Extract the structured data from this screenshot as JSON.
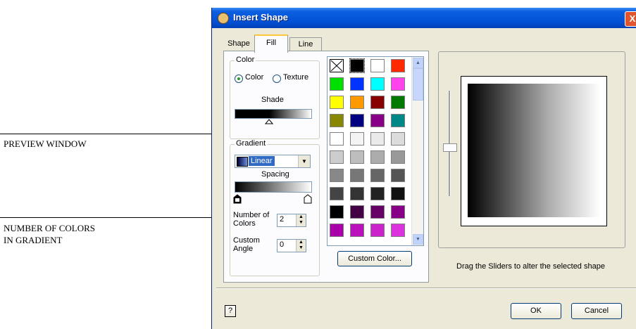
{
  "annotations": {
    "preview_window": "PREVIEW WINDOW",
    "num_colors_line1": "NUMBER OF COLORS",
    "num_colors_line2": "IN GRADIENT"
  },
  "dialog": {
    "title": "Insert Shape",
    "close_glyph": "X",
    "tabs": [
      "Shape",
      "Fill",
      "Line"
    ],
    "active_tab": "Fill"
  },
  "color_group": {
    "label": "Color",
    "radio_color": "Color",
    "radio_texture": "Texture",
    "selected": "Color",
    "shade_label": "Shade"
  },
  "gradient_group": {
    "label": "Gradient",
    "type_value": "Linear",
    "spacing_label": "Spacing",
    "num_colors_label_1": "Number of",
    "num_colors_label_2": "Colors",
    "num_colors_value": "2",
    "custom_angle_label_1": "Custom",
    "custom_angle_label_2": "Angle",
    "custom_angle_value": "0"
  },
  "palette": {
    "colors": [
      [
        "none",
        "#000000",
        "#ffffff",
        "#ff2a00"
      ],
      [
        "#00e000",
        "#0033ff",
        "#00ffff",
        "#ff44ee"
      ],
      [
        "#ffff00",
        "#ff9900",
        "#880000",
        "#007a00"
      ],
      [
        "#888800",
        "#000080",
        "#880088",
        "#008888"
      ],
      [
        "#ffffff",
        "#f4f4f4",
        "#eaeaea",
        "#dcdcdc"
      ],
      [
        "#cccccc",
        "#bdbdbd",
        "#acacac",
        "#999999"
      ],
      [
        "#888888",
        "#777777",
        "#666666",
        "#555555"
      ],
      [
        "#444444",
        "#333333",
        "#222222",
        "#111111"
      ],
      [
        "#000000",
        "#440044",
        "#660066",
        "#880088"
      ],
      [
        "#aa00aa",
        "#bb11bb",
        "#cc22cc",
        "#dd33dd"
      ]
    ]
  },
  "buttons": {
    "custom_color": "Custom Color...",
    "ok": "OK",
    "cancel": "Cancel",
    "help": "?"
  },
  "preview": {
    "hint": "Drag the Sliders to alter the selected shape"
  }
}
